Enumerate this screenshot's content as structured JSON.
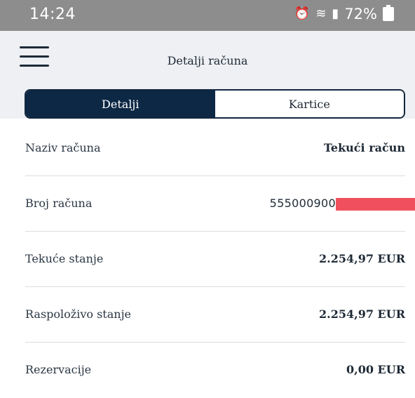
{
  "status_bar": {
    "time": "14:24",
    "battery": "72%",
    "icons": [
      "alarm-icon",
      "wifi-icon",
      "signal-icon",
      "battery-icon"
    ]
  },
  "header": {
    "title": "Detalji računa",
    "menu_icon": "hamburger-icon"
  },
  "tabs": [
    {
      "label": "Detalji",
      "active": true
    },
    {
      "label": "Kartice",
      "active": false
    }
  ],
  "details": [
    {
      "label": "Naziv računa",
      "value": "Tekući račun"
    },
    {
      "label": "Broj računa",
      "value": "555000900"
    },
    {
      "label": "Tekuće stanje",
      "value": "2.254,97 EUR"
    },
    {
      "label": "Raspoloživo stanje",
      "value": "2.254,97 EUR"
    },
    {
      "label": "Rezervacije",
      "value": "0,00 EUR"
    }
  ],
  "colors": {
    "accent": "#0d2845",
    "statusbar": "#8d8d8d",
    "redaction": "#f0505e"
  }
}
